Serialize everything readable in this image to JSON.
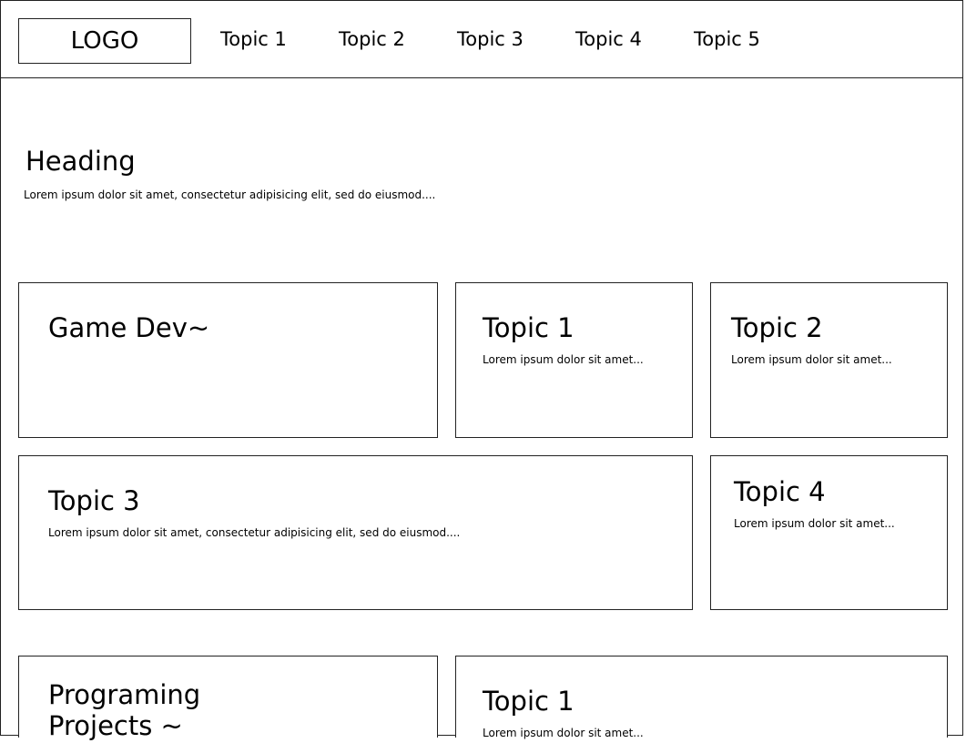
{
  "header": {
    "logo": "LOGO",
    "nav": [
      "Topic 1",
      "Topic 2",
      "Topic 3",
      "Topic 4",
      "Topic 5"
    ]
  },
  "hero": {
    "heading": "Heading",
    "text": "Lorem ipsum dolor sit amet, consectetur adipisicing elit, sed do eiusmod...."
  },
  "cards": {
    "game_dev": {
      "title": "Game Dev~"
    },
    "topic1": {
      "title": "Topic 1",
      "text": "Lorem ipsum dolor sit amet..."
    },
    "topic2": {
      "title": "Topic 2",
      "text": "Lorem ipsum dolor sit amet..."
    },
    "topic3": {
      "title": "Topic 3",
      "text": "Lorem ipsum dolor sit amet, consectetur adipisicing elit, sed do eiusmod...."
    },
    "topic4": {
      "title": "Topic 4",
      "text": "Lorem ipsum dolor sit amet..."
    },
    "programming": {
      "title_line1": "Programing",
      "title_line2": "Projects ~"
    },
    "topic1_bottom": {
      "title": "Topic 1",
      "text": "Lorem ipsum dolor sit amet..."
    }
  }
}
